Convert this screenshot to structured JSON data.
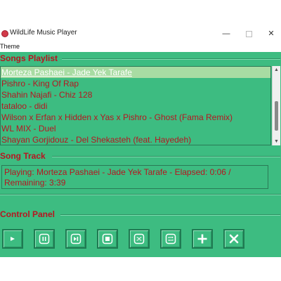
{
  "window": {
    "title": "WildLife Music Player",
    "minimize_glyph": "—",
    "close_glyph": "✕"
  },
  "menubar": {
    "theme": "Theme"
  },
  "playlist": {
    "heading": "Songs Playlist",
    "items": [
      "Morteza Pashaei - Jade Yek Tarafe",
      "Pishro - King Of Rap",
      "Shahin Najafi - Chiz 128",
      "tataloo - didi",
      "Wilson x Erfan x Hidden x Yas x Pishro - Ghost (Fama Remix)",
      "WL MIX - Duel",
      "Shayan Gorjidouz - Del Shekasteh (feat. Hayedeh)"
    ],
    "selected_index": 0
  },
  "track": {
    "heading": "Song Track",
    "status": "Playing: Morteza Pashaei - Jade Yek Tarafe - Elapsed: 0:06 / Remaining: 3:39"
  },
  "controls": {
    "heading": "Control Panel",
    "buttons": [
      {
        "name": "play-icon"
      },
      {
        "name": "pause-icon"
      },
      {
        "name": "next-icon"
      },
      {
        "name": "stop-icon"
      },
      {
        "name": "shuffle-icon"
      },
      {
        "name": "repeat-icon"
      },
      {
        "name": "add-icon"
      },
      {
        "name": "remove-icon"
      }
    ]
  },
  "colors": {
    "background": "#3dbc81",
    "text": "#b71520",
    "selection": "#a8dca3",
    "icon": "#ffffff"
  }
}
